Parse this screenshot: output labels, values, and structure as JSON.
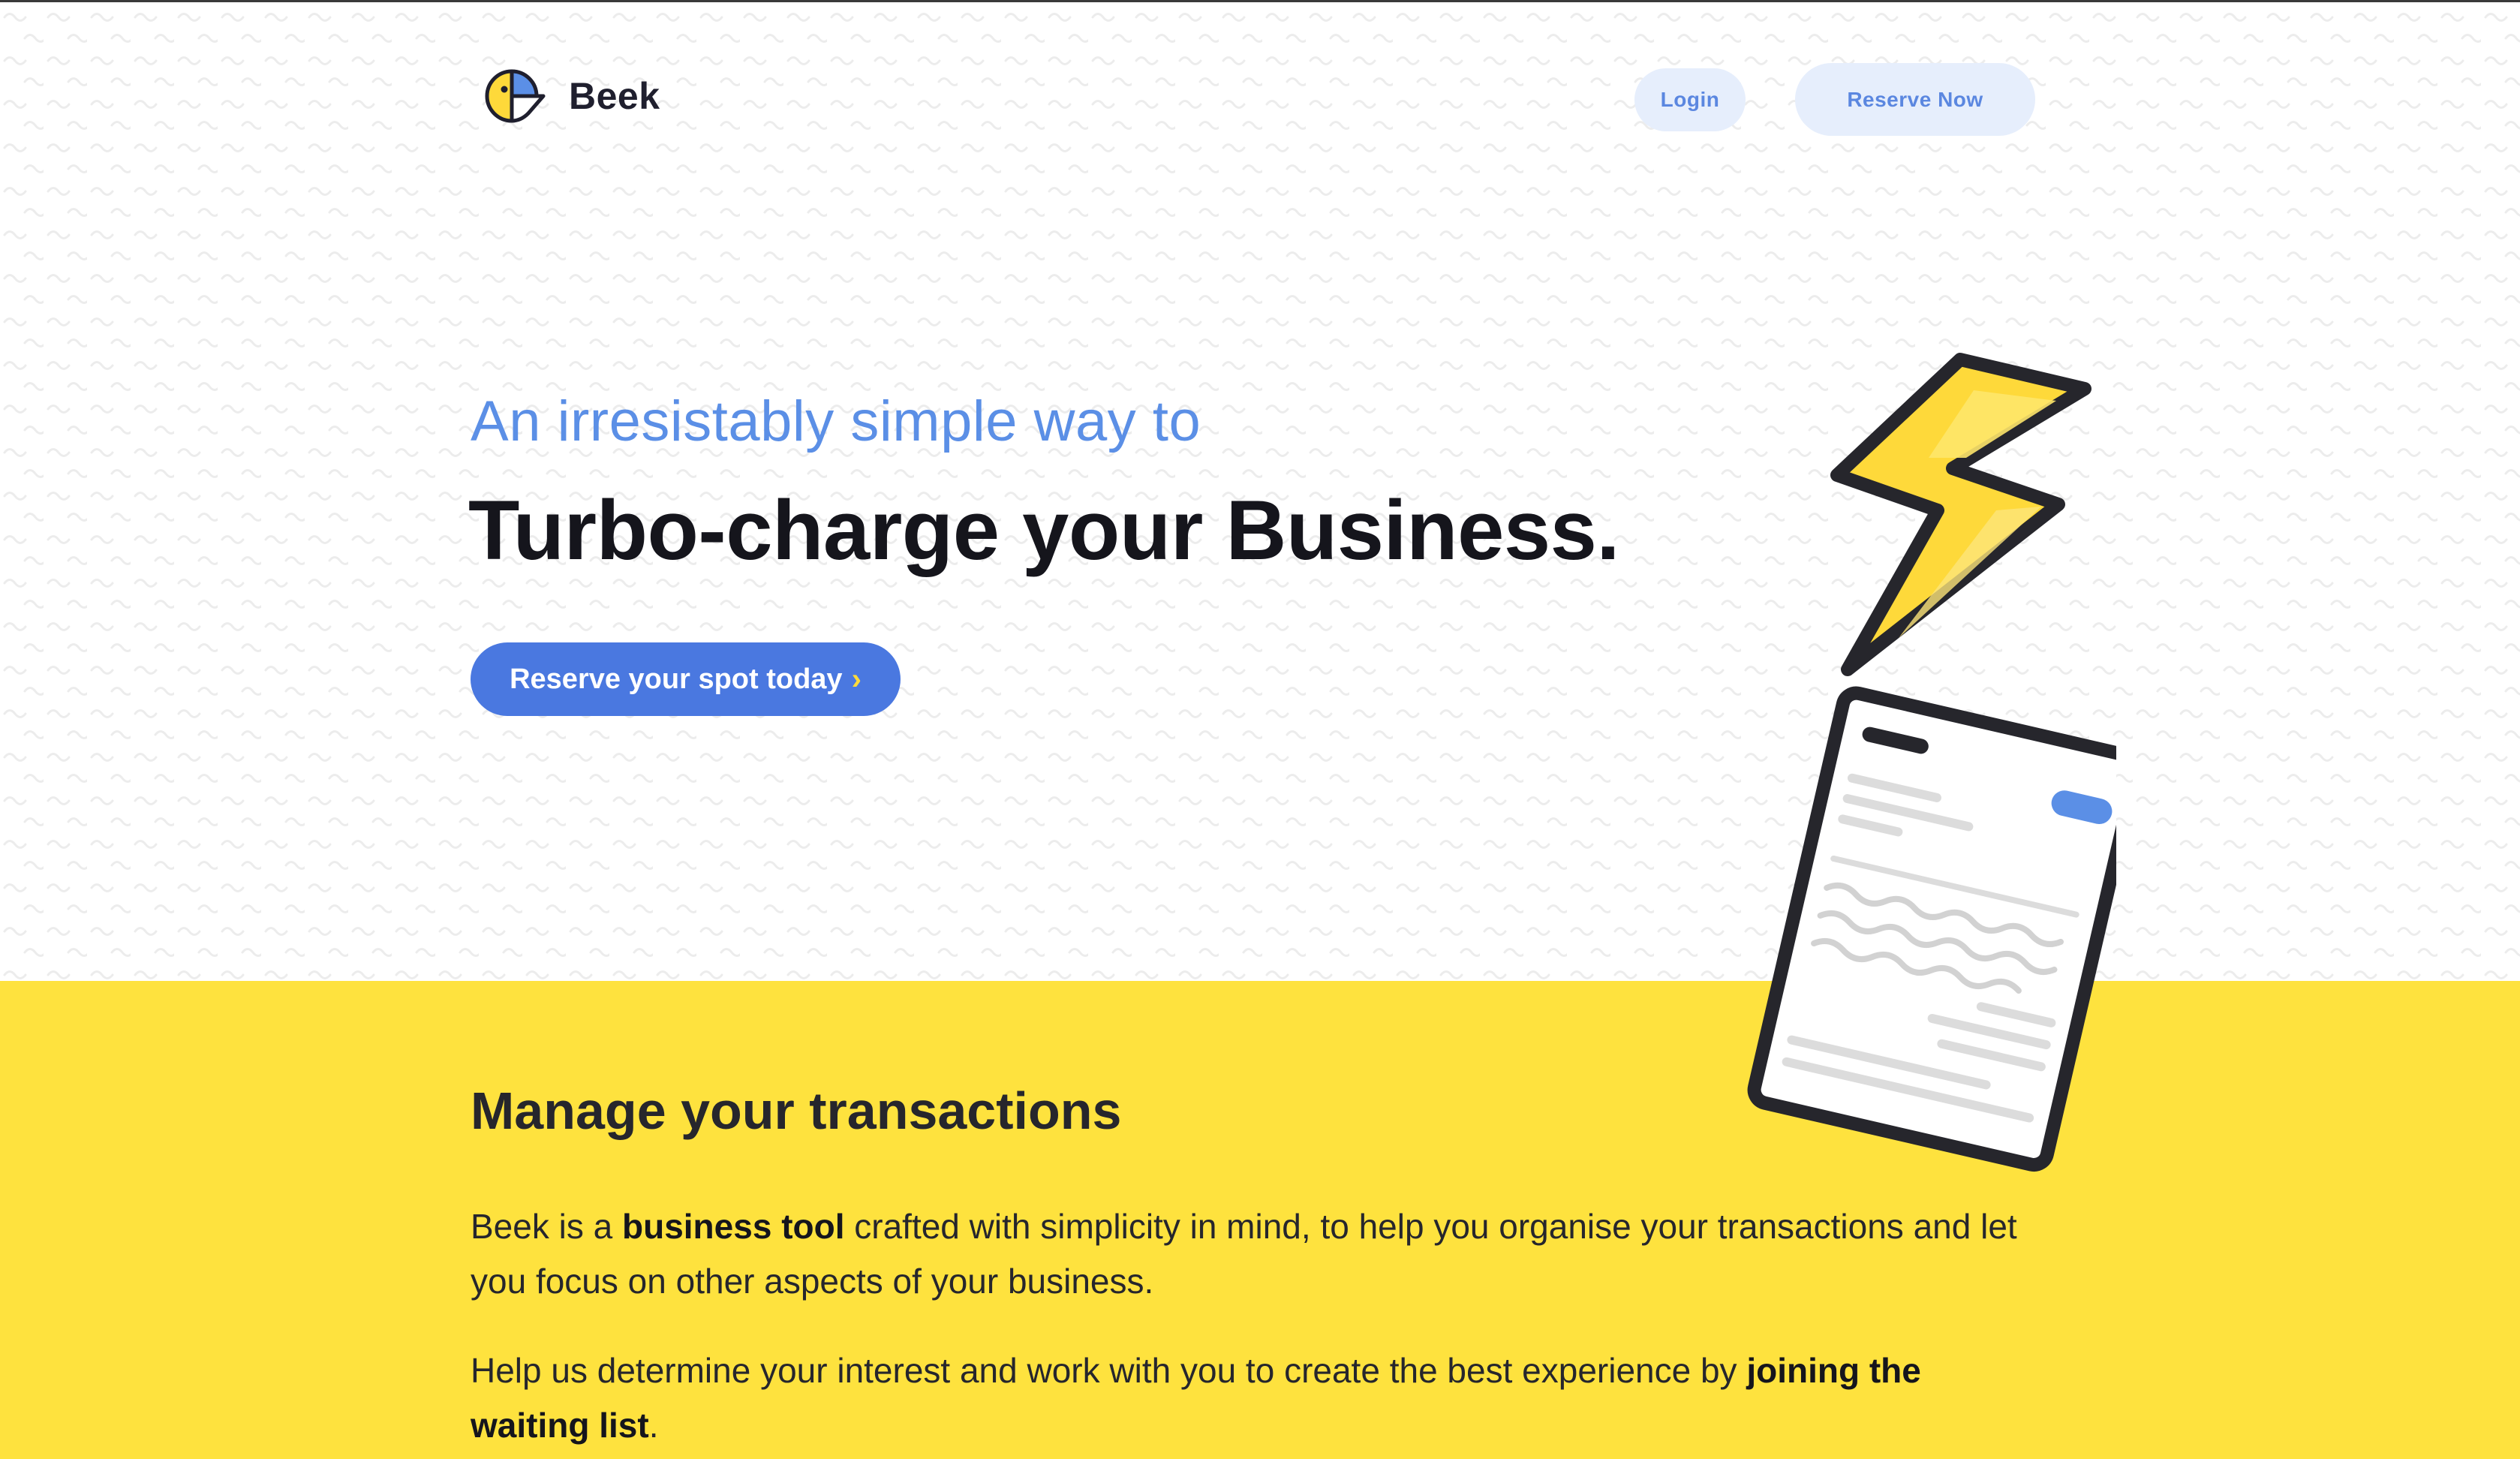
{
  "header": {
    "logo_text": "Beek",
    "login_label": "Login",
    "reserve_label": "Reserve Now"
  },
  "hero": {
    "tagline": "An irresistably simple way to",
    "headline": "Turbo-charge your Business.",
    "cta_label": "Reserve your spot today",
    "cta_chevron": "›"
  },
  "section": {
    "title": "Manage your transactions",
    "p1_a": "Beek is a ",
    "p1_b": "business tool",
    "p1_c": " crafted with simplicity in mind, to help you organise your transactions and let you focus on other aspects of your business.",
    "p2_a": "Help us determine your interest and work with you to create the best experience by ",
    "p2_b": "joining the waiting list",
    "p2_c": "."
  },
  "icons": {
    "logo": "beek-logo-icon",
    "illustration": "lightning-document-illustration"
  },
  "colors": {
    "accent_blue": "#4a78e0",
    "tagline_blue": "#5b8fe6",
    "nav_button_bg": "#e6eefc",
    "brand_yellow": "#fee23e",
    "text_dark": "#15151c"
  }
}
